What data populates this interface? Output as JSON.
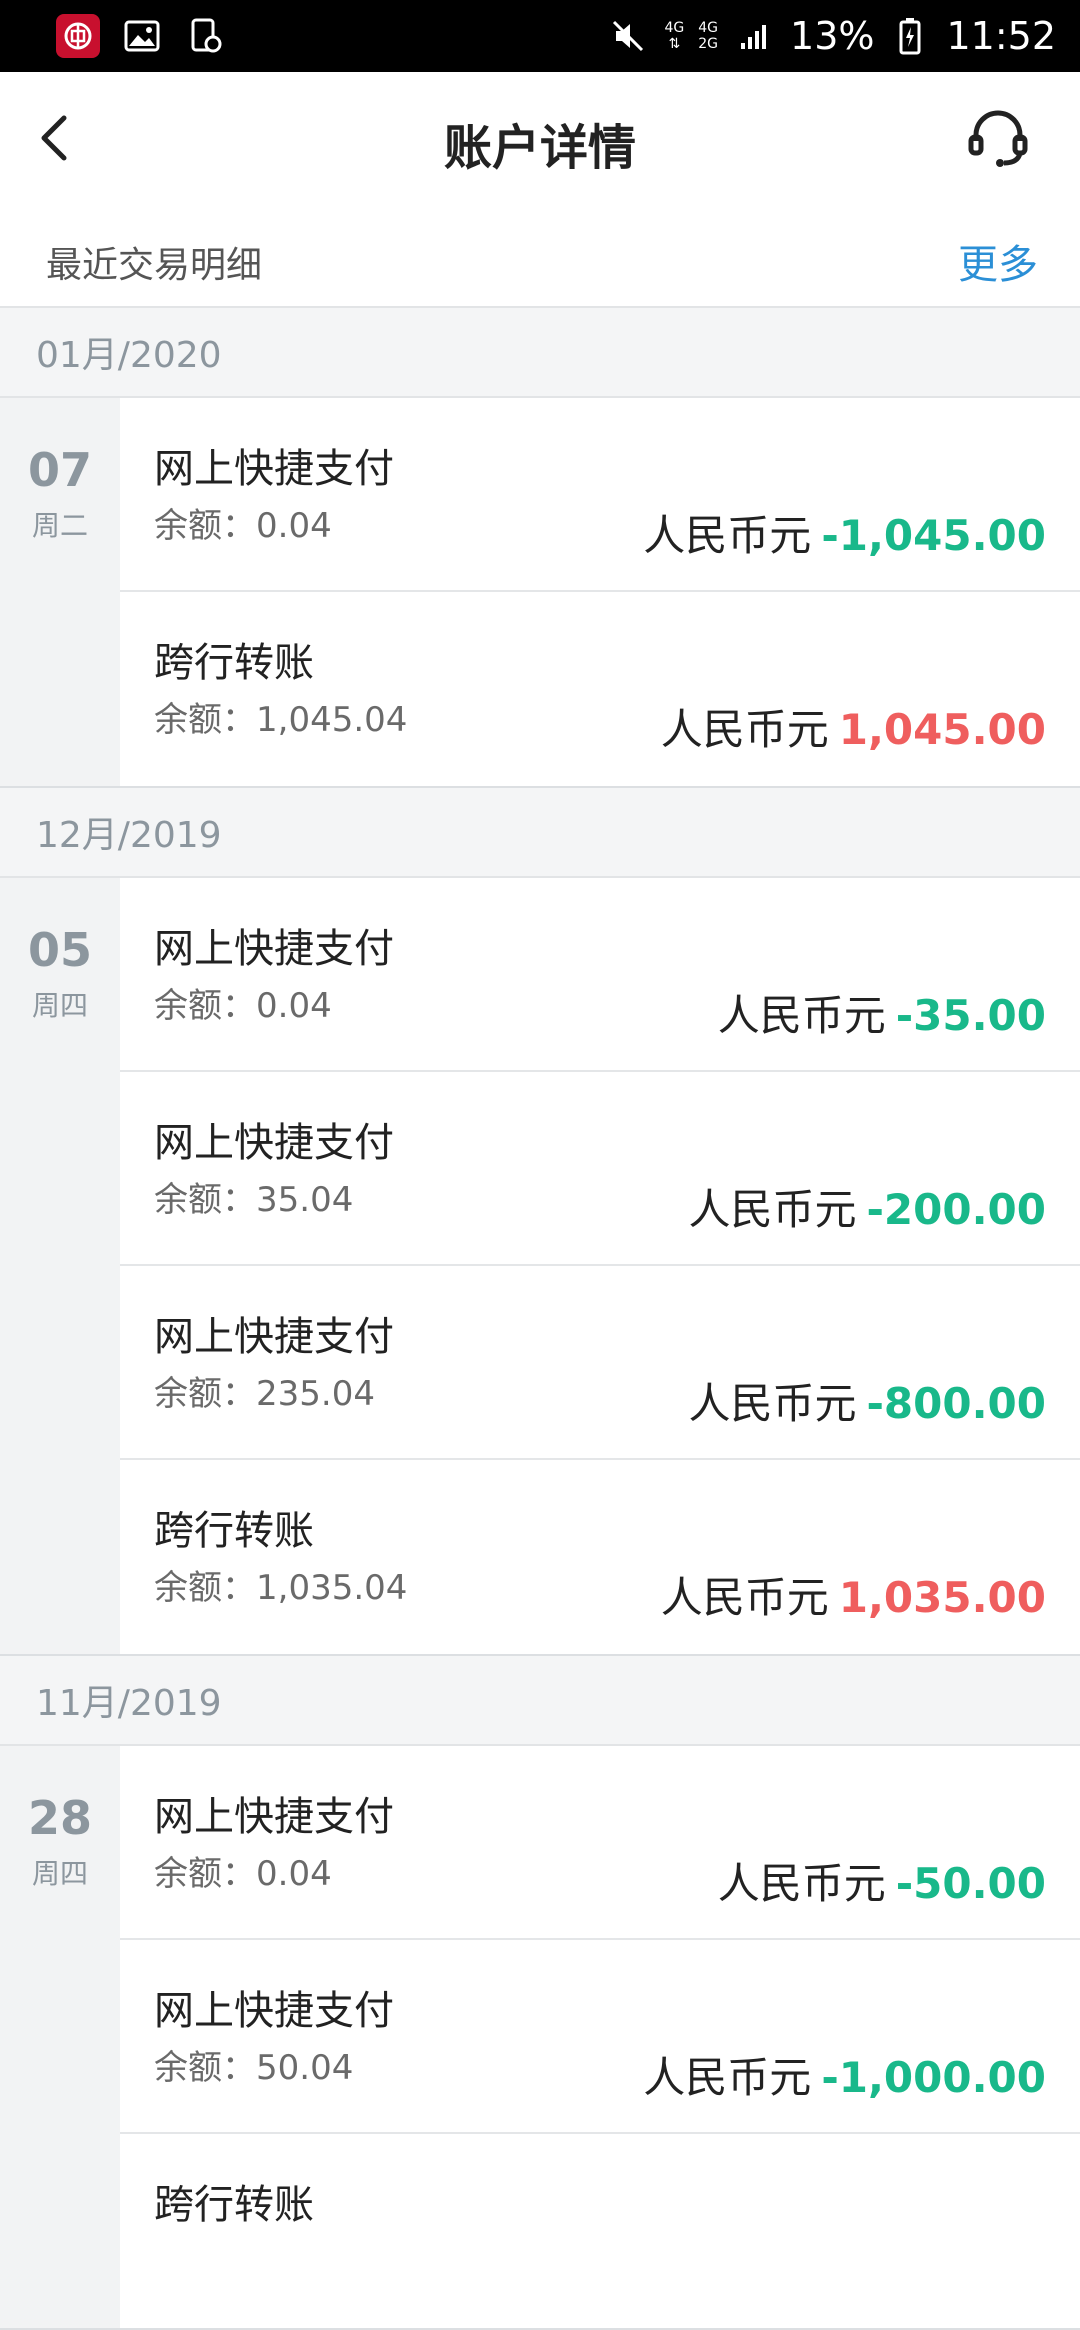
{
  "status_bar": {
    "battery": "13%",
    "time": "11:52",
    "net_top": "4G",
    "net_mid": "4G",
    "net_bottom": "2G"
  },
  "header": {
    "title": "账户详情"
  },
  "recent": {
    "title": "最近交易明细",
    "more": "更多"
  },
  "currency_label": "人民币元",
  "balance_prefix": "余额：",
  "months": [
    {
      "label": "01月/2020",
      "days": [
        {
          "day": "07",
          "weekday": "周二",
          "items": [
            {
              "title": "网上快捷支付",
              "balance": "余额：0.04",
              "currency": "人民币元",
              "amount": "-1,045.00",
              "type": "debit"
            },
            {
              "title": "跨行转账",
              "balance": "余额：1,045.04",
              "currency": "人民币元",
              "amount": "1,045.00",
              "type": "credit"
            }
          ]
        }
      ]
    },
    {
      "label": "12月/2019",
      "days": [
        {
          "day": "05",
          "weekday": "周四",
          "items": [
            {
              "title": "网上快捷支付",
              "balance": "余额：0.04",
              "currency": "人民币元",
              "amount": "-35.00",
              "type": "debit"
            },
            {
              "title": "网上快捷支付",
              "balance": "余额：35.04",
              "currency": "人民币元",
              "amount": "-200.00",
              "type": "debit"
            },
            {
              "title": "网上快捷支付",
              "balance": "余额：235.04",
              "currency": "人民币元",
              "amount": "-800.00",
              "type": "debit"
            },
            {
              "title": "跨行转账",
              "balance": "余额：1,035.04",
              "currency": "人民币元",
              "amount": "1,035.00",
              "type": "credit"
            }
          ]
        }
      ]
    },
    {
      "label": "11月/2019",
      "days": [
        {
          "day": "28",
          "weekday": "周四",
          "items": [
            {
              "title": "网上快捷支付",
              "balance": "余额：0.04",
              "currency": "人民币元",
              "amount": "-50.00",
              "type": "debit"
            },
            {
              "title": "网上快捷支付",
              "balance": "余额：50.04",
              "currency": "人民币元",
              "amount": "-1,000.00",
              "type": "debit"
            },
            {
              "title": "跨行转账",
              "balance": "",
              "currency": "",
              "amount": "",
              "type": "credit"
            }
          ]
        }
      ]
    }
  ],
  "colors": {
    "debit": "#19b88a",
    "credit": "#ef5e5e",
    "link": "#2b8fd6"
  },
  "icons": {
    "back": "chevron-left-icon",
    "service": "headset-icon"
  }
}
